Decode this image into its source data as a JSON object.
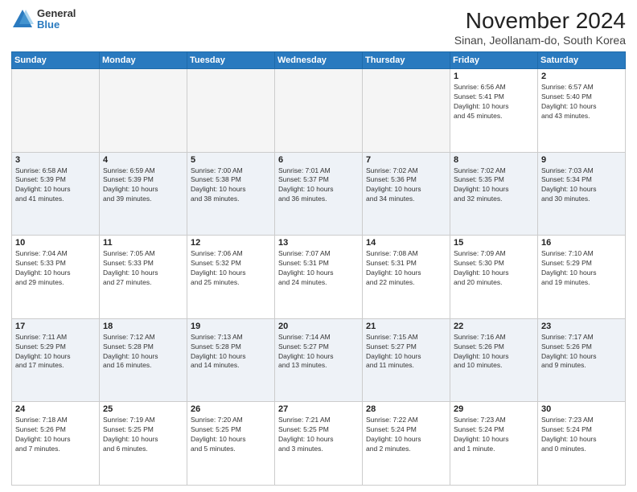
{
  "logo": {
    "general": "General",
    "blue": "Blue"
  },
  "title": "November 2024",
  "location": "Sinan, Jeollanam-do, South Korea",
  "weekdays": [
    "Sunday",
    "Monday",
    "Tuesday",
    "Wednesday",
    "Thursday",
    "Friday",
    "Saturday"
  ],
  "weeks": [
    [
      {
        "day": "",
        "info": ""
      },
      {
        "day": "",
        "info": ""
      },
      {
        "day": "",
        "info": ""
      },
      {
        "day": "",
        "info": ""
      },
      {
        "day": "",
        "info": ""
      },
      {
        "day": "1",
        "info": "Sunrise: 6:56 AM\nSunset: 5:41 PM\nDaylight: 10 hours\nand 45 minutes."
      },
      {
        "day": "2",
        "info": "Sunrise: 6:57 AM\nSunset: 5:40 PM\nDaylight: 10 hours\nand 43 minutes."
      }
    ],
    [
      {
        "day": "3",
        "info": "Sunrise: 6:58 AM\nSunset: 5:39 PM\nDaylight: 10 hours\nand 41 minutes."
      },
      {
        "day": "4",
        "info": "Sunrise: 6:59 AM\nSunset: 5:39 PM\nDaylight: 10 hours\nand 39 minutes."
      },
      {
        "day": "5",
        "info": "Sunrise: 7:00 AM\nSunset: 5:38 PM\nDaylight: 10 hours\nand 38 minutes."
      },
      {
        "day": "6",
        "info": "Sunrise: 7:01 AM\nSunset: 5:37 PM\nDaylight: 10 hours\nand 36 minutes."
      },
      {
        "day": "7",
        "info": "Sunrise: 7:02 AM\nSunset: 5:36 PM\nDaylight: 10 hours\nand 34 minutes."
      },
      {
        "day": "8",
        "info": "Sunrise: 7:02 AM\nSunset: 5:35 PM\nDaylight: 10 hours\nand 32 minutes."
      },
      {
        "day": "9",
        "info": "Sunrise: 7:03 AM\nSunset: 5:34 PM\nDaylight: 10 hours\nand 30 minutes."
      }
    ],
    [
      {
        "day": "10",
        "info": "Sunrise: 7:04 AM\nSunset: 5:33 PM\nDaylight: 10 hours\nand 29 minutes."
      },
      {
        "day": "11",
        "info": "Sunrise: 7:05 AM\nSunset: 5:33 PM\nDaylight: 10 hours\nand 27 minutes."
      },
      {
        "day": "12",
        "info": "Sunrise: 7:06 AM\nSunset: 5:32 PM\nDaylight: 10 hours\nand 25 minutes."
      },
      {
        "day": "13",
        "info": "Sunrise: 7:07 AM\nSunset: 5:31 PM\nDaylight: 10 hours\nand 24 minutes."
      },
      {
        "day": "14",
        "info": "Sunrise: 7:08 AM\nSunset: 5:31 PM\nDaylight: 10 hours\nand 22 minutes."
      },
      {
        "day": "15",
        "info": "Sunrise: 7:09 AM\nSunset: 5:30 PM\nDaylight: 10 hours\nand 20 minutes."
      },
      {
        "day": "16",
        "info": "Sunrise: 7:10 AM\nSunset: 5:29 PM\nDaylight: 10 hours\nand 19 minutes."
      }
    ],
    [
      {
        "day": "17",
        "info": "Sunrise: 7:11 AM\nSunset: 5:29 PM\nDaylight: 10 hours\nand 17 minutes."
      },
      {
        "day": "18",
        "info": "Sunrise: 7:12 AM\nSunset: 5:28 PM\nDaylight: 10 hours\nand 16 minutes."
      },
      {
        "day": "19",
        "info": "Sunrise: 7:13 AM\nSunset: 5:28 PM\nDaylight: 10 hours\nand 14 minutes."
      },
      {
        "day": "20",
        "info": "Sunrise: 7:14 AM\nSunset: 5:27 PM\nDaylight: 10 hours\nand 13 minutes."
      },
      {
        "day": "21",
        "info": "Sunrise: 7:15 AM\nSunset: 5:27 PM\nDaylight: 10 hours\nand 11 minutes."
      },
      {
        "day": "22",
        "info": "Sunrise: 7:16 AM\nSunset: 5:26 PM\nDaylight: 10 hours\nand 10 minutes."
      },
      {
        "day": "23",
        "info": "Sunrise: 7:17 AM\nSunset: 5:26 PM\nDaylight: 10 hours\nand 9 minutes."
      }
    ],
    [
      {
        "day": "24",
        "info": "Sunrise: 7:18 AM\nSunset: 5:26 PM\nDaylight: 10 hours\nand 7 minutes."
      },
      {
        "day": "25",
        "info": "Sunrise: 7:19 AM\nSunset: 5:25 PM\nDaylight: 10 hours\nand 6 minutes."
      },
      {
        "day": "26",
        "info": "Sunrise: 7:20 AM\nSunset: 5:25 PM\nDaylight: 10 hours\nand 5 minutes."
      },
      {
        "day": "27",
        "info": "Sunrise: 7:21 AM\nSunset: 5:25 PM\nDaylight: 10 hours\nand 3 minutes."
      },
      {
        "day": "28",
        "info": "Sunrise: 7:22 AM\nSunset: 5:24 PM\nDaylight: 10 hours\nand 2 minutes."
      },
      {
        "day": "29",
        "info": "Sunrise: 7:23 AM\nSunset: 5:24 PM\nDaylight: 10 hours\nand 1 minute."
      },
      {
        "day": "30",
        "info": "Sunrise: 7:23 AM\nSunset: 5:24 PM\nDaylight: 10 hours\nand 0 minutes."
      }
    ]
  ]
}
